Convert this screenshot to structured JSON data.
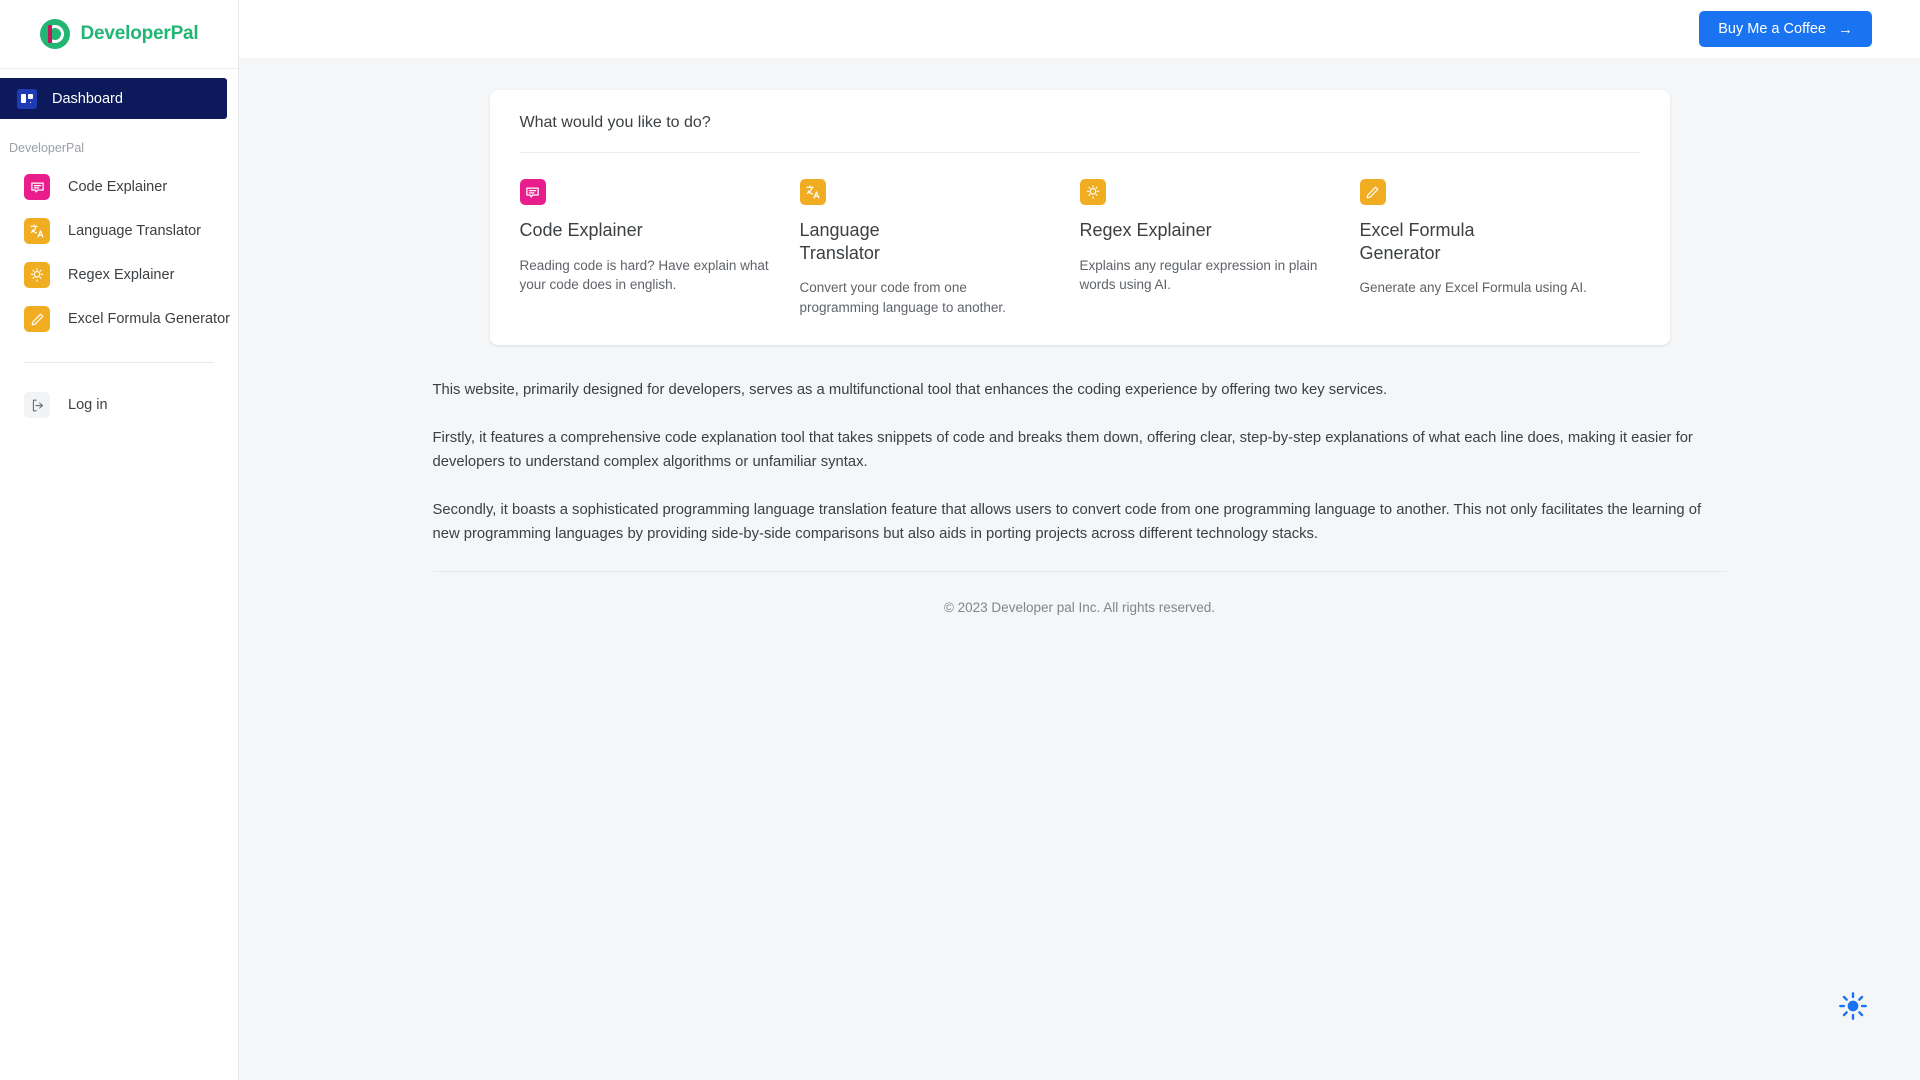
{
  "brand": {
    "name": "DeveloperPal",
    "logo_icon": "developerpal-logo"
  },
  "sidebar": {
    "active_item": {
      "label": "Dashboard",
      "icon": "dashboard-icon"
    },
    "section_title": "DeveloperPal",
    "items": [
      {
        "label": "Code Explainer",
        "icon": "chat-bubble-icon",
        "color": "#e91e8c"
      },
      {
        "label": "Language Translator",
        "icon": "translate-icon",
        "color": "#f0ad22"
      },
      {
        "label": "Regex Explainer",
        "icon": "lightbulb-icon",
        "color": "#f0ad22"
      },
      {
        "label": "Excel Formula Generator",
        "icon": "pencil-icon",
        "color": "#f0ad22"
      }
    ],
    "login": {
      "label": "Log in",
      "icon": "login-arrow-icon"
    }
  },
  "topbar": {
    "coffee_label": "Buy Me a Coffee",
    "coffee_arrow": "→",
    "coffee_color": "#1a73f0"
  },
  "card": {
    "title": "What would you like to do?",
    "tools": [
      {
        "title": "Code Explainer",
        "description": "Reading code is hard? Have explain what your code does in english.",
        "icon": "chat-bubble-icon",
        "color": "#e91e8c"
      },
      {
        "title": "Language Translator",
        "description": "Convert your code from one programming language to another.",
        "icon": "translate-icon",
        "color": "#f0ad22"
      },
      {
        "title": "Regex Explainer",
        "description": "Explains any regular expression in plain words using AI.",
        "icon": "lightbulb-icon",
        "color": "#f0ad22"
      },
      {
        "title": "Excel Formula Generator",
        "description": "Generate any Excel Formula using AI.",
        "icon": "pencil-icon",
        "color": "#f0ad22"
      }
    ]
  },
  "prose": {
    "p1": "This website, primarily designed for developers, serves as a multifunctional tool that enhances the coding experience by offering two key services.",
    "p2": "Firstly, it features a comprehensive code explanation tool that takes snippets of code and breaks them down, offering clear, step-by-step explanations of what each line does, making it easier for developers to understand complex algorithms or unfamiliar syntax.",
    "p3": "Secondly, it boasts a sophisticated programming language translation feature that allows users to convert code from one programming language to another. This not only facilitates the learning of new programming languages by providing side-by-side comparisons but also aids in porting projects across different technology stacks."
  },
  "footer": {
    "copyright": "© 2023 Developer pal Inc. All rights reserved."
  },
  "theme_toggle": {
    "icon": "sun-icon",
    "color": "#1a73f0"
  }
}
